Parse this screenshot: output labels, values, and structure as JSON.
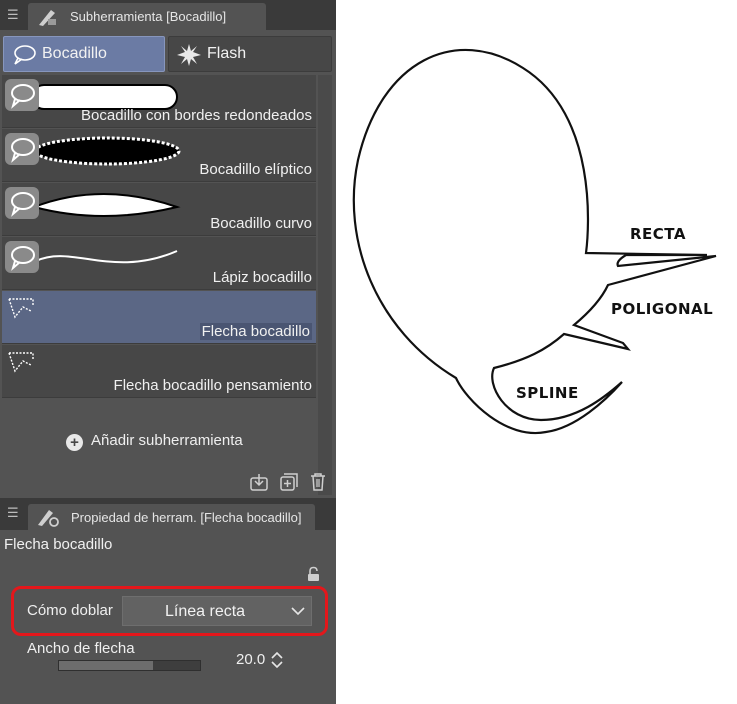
{
  "subtool_panel": {
    "tab_title": "Subherramienta [Bocadillo]",
    "groups": [
      {
        "label": "Bocadillo",
        "icon": "speech-balloon-icon",
        "selected": true
      },
      {
        "label": "Flash",
        "icon": "flash-burst-icon",
        "selected": false
      }
    ],
    "items": [
      {
        "label": "Bocadillo con bordes redondeados",
        "icon": "balloon-tool-icon"
      },
      {
        "label": "Bocadillo elíptico",
        "icon": "balloon-tool-icon"
      },
      {
        "label": "Bocadillo curvo",
        "icon": "balloon-tool-icon"
      },
      {
        "label": "Lápiz bocadillo",
        "icon": "balloon-tool-icon"
      },
      {
        "label": "Flecha bocadillo",
        "icon": "balloon-tail-icon",
        "selected": true
      },
      {
        "label": "Flecha bocadillo pensamiento",
        "icon": "balloon-tail-icon"
      }
    ],
    "add_label": "Añadir subherramienta"
  },
  "property_panel": {
    "tab_title": "Propiedad de herram. [Flecha bocadillo]",
    "section_title": "Flecha bocadillo",
    "bend_label": "Cómo doblar",
    "bend_value": "Línea recta",
    "width_label": "Ancho de flecha",
    "width_value": "20.0",
    "width_fraction": 0.67
  },
  "canvas": {
    "label_straight": "RECTA",
    "label_polyline": "POLIGONAL",
    "label_spline": "SPLINE"
  },
  "colors": {
    "selected_item": "#5b6785",
    "highlight": "#e4171b"
  }
}
